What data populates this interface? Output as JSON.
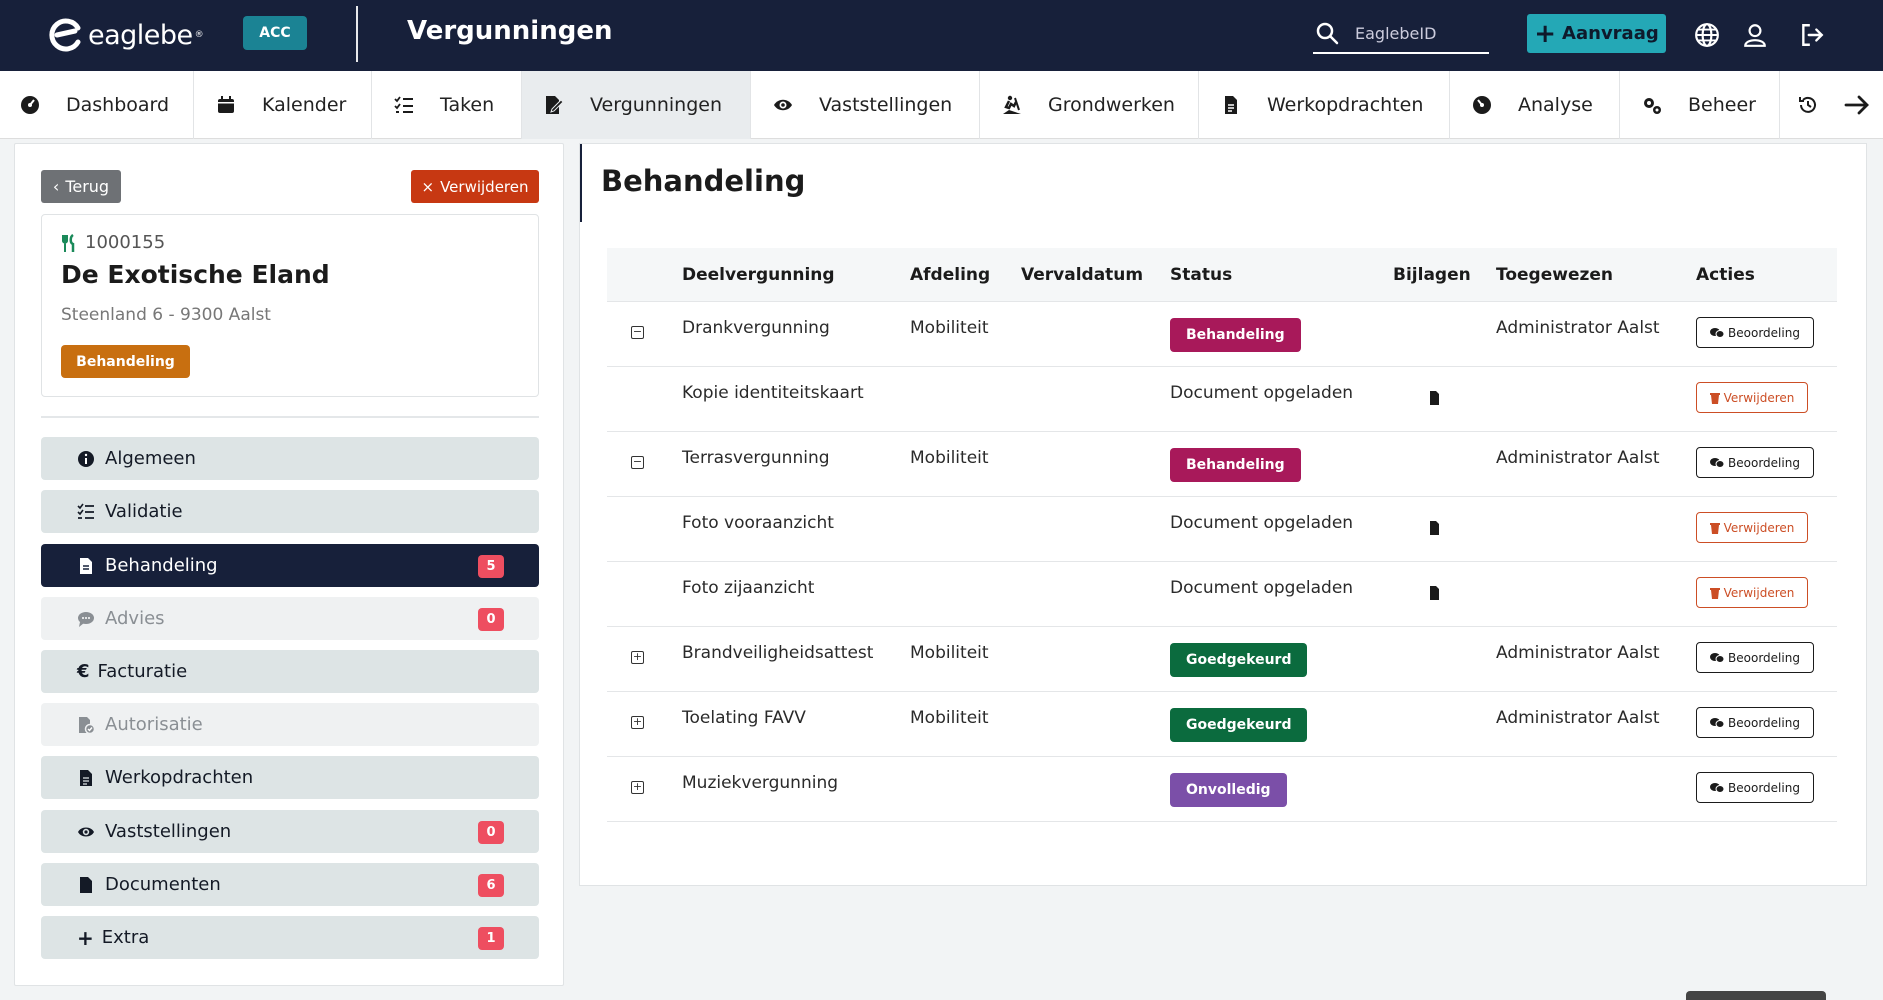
{
  "topbar": {
    "brand": "eaglebe",
    "brand_tm": "®",
    "env_badge": "ACC",
    "page_title": "Vergunningen",
    "search_placeholder": "EaglebeID",
    "new_request_label": "Aanvraag",
    "colors": {
      "background": "#17203a",
      "accent": "#24a8b6",
      "env": "#1b8394"
    }
  },
  "nav": {
    "items": [
      {
        "label": "Dashboard",
        "icon": "dashboard-icon"
      },
      {
        "label": "Kalender",
        "icon": "calendar-icon"
      },
      {
        "label": "Taken",
        "icon": "tasks-icon"
      },
      {
        "label": "Vergunningen",
        "icon": "permit-icon",
        "active": true
      },
      {
        "label": "Vaststellingen",
        "icon": "eye-icon"
      },
      {
        "label": "Grondwerken",
        "icon": "digging-icon"
      },
      {
        "label": "Werkopdrachten",
        "icon": "file-icon"
      },
      {
        "label": "Analyse",
        "icon": "chart-icon"
      },
      {
        "label": "Beheer",
        "icon": "gears-icon"
      }
    ]
  },
  "left": {
    "back_label": "Terug",
    "delete_label": "Verwijderen",
    "card": {
      "id": "1000155",
      "name": "De Exotische Eland",
      "address": "Steenland 6 - 9300 Aalst",
      "status": "Behandeling",
      "status_color": "#c86f10"
    },
    "menu": [
      {
        "label": "Algemeen",
        "icon": "info-icon",
        "count": null,
        "state": "normal"
      },
      {
        "label": "Validatie",
        "icon": "checklist-icon",
        "count": null,
        "state": "normal"
      },
      {
        "label": "Behandeling",
        "icon": "file-icon",
        "count": "5",
        "state": "active"
      },
      {
        "label": "Advies",
        "icon": "comments-icon",
        "count": "0",
        "state": "muted"
      },
      {
        "label": "Facturatie",
        "icon": "euro-icon",
        "count": null,
        "state": "normal"
      },
      {
        "label": "Autorisatie",
        "icon": "file-check-icon",
        "count": null,
        "state": "muted"
      },
      {
        "label": "Werkopdrachten",
        "icon": "file-icon",
        "count": null,
        "state": "normal"
      },
      {
        "label": "Vaststellingen",
        "icon": "eye-icon",
        "count": "0",
        "state": "normal"
      },
      {
        "label": "Documenten",
        "icon": "file-icon",
        "count": "6",
        "state": "normal"
      },
      {
        "label": "Extra",
        "icon": "plus-icon",
        "count": "1",
        "state": "normal"
      }
    ]
  },
  "main": {
    "title": "Behandeling",
    "columns": [
      "Deelvergunning",
      "Afdeling",
      "Vervaldatum",
      "Status",
      "Bijlagen",
      "Toegewezen",
      "Acties"
    ],
    "rows": [
      {
        "type": "permit",
        "toggle": "−",
        "name": "Drankvergunning",
        "dept": "Mobiliteit",
        "due": "",
        "status": "Behandeling",
        "status_color": "#a8195a",
        "assigned": "Administrator Aalst",
        "action": "Beoordeling"
      },
      {
        "type": "doc",
        "name": "Kopie identiteitskaart",
        "status": "Document opgeladen",
        "action": "Verwijderen"
      },
      {
        "type": "permit",
        "toggle": "−",
        "name": "Terrasvergunning",
        "dept": "Mobiliteit",
        "due": "",
        "status": "Behandeling",
        "status_color": "#a8195a",
        "assigned": "Administrator Aalst",
        "action": "Beoordeling"
      },
      {
        "type": "doc",
        "name": "Foto vooraanzicht",
        "status": "Document opgeladen",
        "action": "Verwijderen"
      },
      {
        "type": "doc",
        "name": "Foto zijaanzicht",
        "status": "Document opgeladen",
        "action": "Verwijderen"
      },
      {
        "type": "permit",
        "toggle": "+",
        "name": "Brandveiligheidsattest",
        "dept": "Mobiliteit",
        "due": "",
        "status": "Goedgekeurd",
        "status_color": "#0b6b3e",
        "assigned": "Administrator Aalst",
        "action": "Beoordeling"
      },
      {
        "type": "permit",
        "toggle": "+",
        "name": "Toelating FAVV",
        "dept": "Mobiliteit",
        "due": "",
        "status": "Goedgekeurd",
        "status_color": "#0b6b3e",
        "assigned": "Administrator Aalst",
        "action": "Beoordeling"
      },
      {
        "type": "permit",
        "toggle": "+",
        "name": "Muziekvergunning",
        "dept": "",
        "due": "",
        "status": "Onvolledig",
        "status_color": "#7b4fa8",
        "assigned": "",
        "action": "Beoordeling"
      }
    ]
  }
}
